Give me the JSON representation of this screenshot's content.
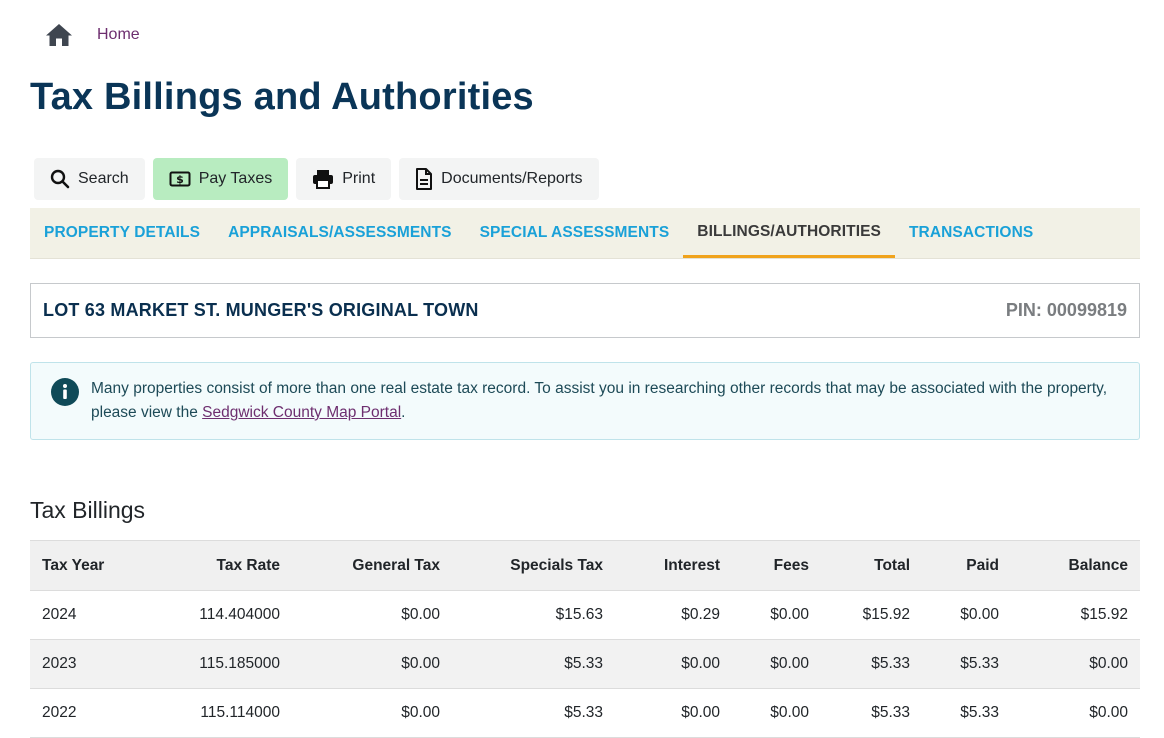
{
  "breadcrumb": {
    "home_icon": "home-icon",
    "home_label": "Home"
  },
  "page_title": "Tax Billings and Authorities",
  "toolbar": {
    "search_label": "Search",
    "pay_label": "Pay Taxes",
    "print_label": "Print",
    "documents_label": "Documents/Reports",
    "pay_color": "#b8ecc0"
  },
  "tabs": [
    {
      "label": "PROPERTY DETAILS",
      "active": false
    },
    {
      "label": "APPRAISALS/ASSESSMENTS",
      "active": false
    },
    {
      "label": "SPECIAL ASSESSMENTS",
      "active": false
    },
    {
      "label": "BILLINGS/AUTHORITIES",
      "active": true
    },
    {
      "label": "TRANSACTIONS",
      "active": false
    }
  ],
  "property": {
    "description": "LOT 63 MARKET ST. MUNGER'S ORIGINAL TOWN",
    "pin": "PIN: 00099819"
  },
  "info_alert": {
    "text_before": "Many properties consist of more than one real estate tax record. To assist you in researching other records that may be associated with the property, please view the ",
    "link_text": "Sedgwick County Map Portal",
    "text_after": "."
  },
  "tax_billings": {
    "title": "Tax Billings",
    "columns": [
      "Tax Year",
      "Tax Rate",
      "General Tax",
      "Specials Tax",
      "Interest",
      "Fees",
      "Total",
      "Paid",
      "Balance"
    ],
    "rows": [
      [
        "2024",
        "114.404000",
        "$0.00",
        "$15.63",
        "$0.29",
        "$0.00",
        "$15.92",
        "$0.00",
        "$15.92"
      ],
      [
        "2023",
        "115.185000",
        "$0.00",
        "$5.33",
        "$0.00",
        "$0.00",
        "$5.33",
        "$5.33",
        "$0.00"
      ],
      [
        "2022",
        "115.114000",
        "$0.00",
        "$5.33",
        "$0.00",
        "$0.00",
        "$5.33",
        "$5.33",
        "$0.00"
      ]
    ]
  },
  "colors": {
    "title": "#0a3557",
    "tab_link": "#1aa1d8",
    "tab_active_underline": "#f0a31c",
    "link": "#6d2e6f"
  }
}
